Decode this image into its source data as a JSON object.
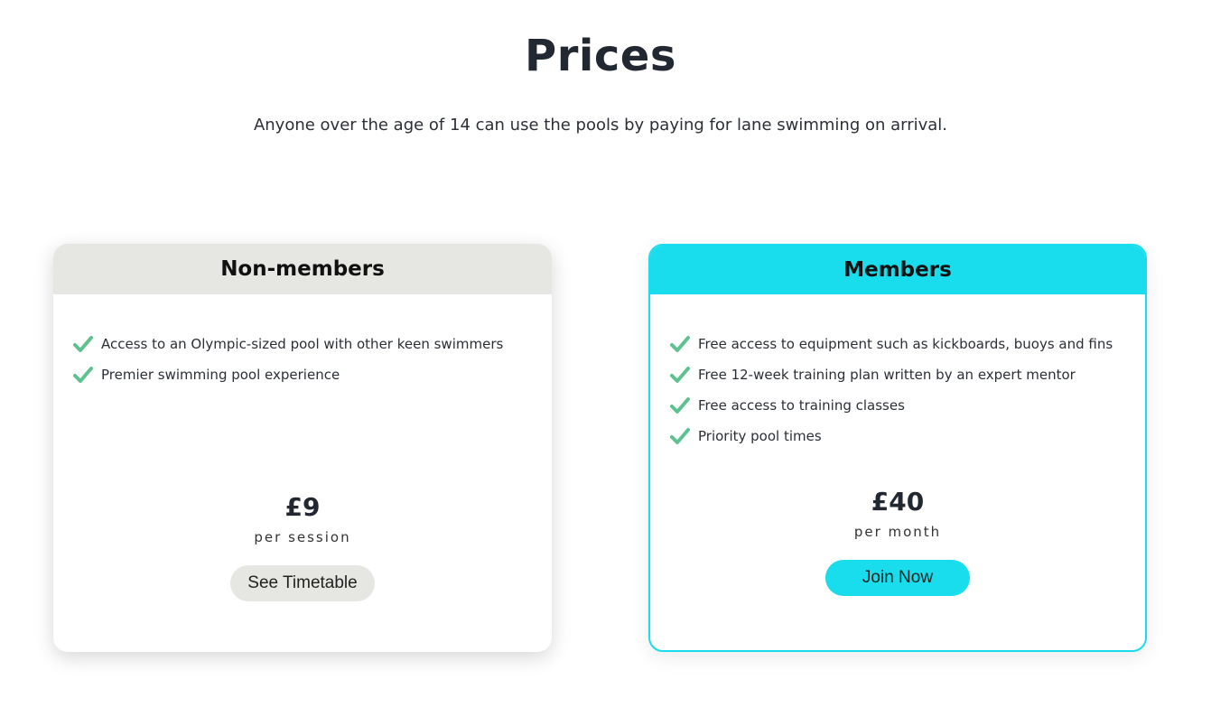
{
  "header": {
    "title": "Prices",
    "subtitle": "Anyone over the age of 14 can use the pools by paying for lane swimming on arrival."
  },
  "colors": {
    "accent": "#19dcec",
    "neutral": "#e6e6e2",
    "check": "#5fc18f"
  },
  "plans": {
    "non_members": {
      "title": "Non-members",
      "features": [
        "Access to an Olympic-sized pool with other keen swimmers",
        "Premier swimming pool experience"
      ],
      "price": "£9",
      "period": "per session",
      "cta": "See Timetable"
    },
    "members": {
      "title": "Members",
      "features": [
        "Free access to equipment such as kickboards, buoys and fins",
        "Free 12-week training plan written by an expert mentor",
        "Free access to training classes",
        "Priority pool times"
      ],
      "price": "£40",
      "period": "per month",
      "cta": "Join Now"
    }
  }
}
